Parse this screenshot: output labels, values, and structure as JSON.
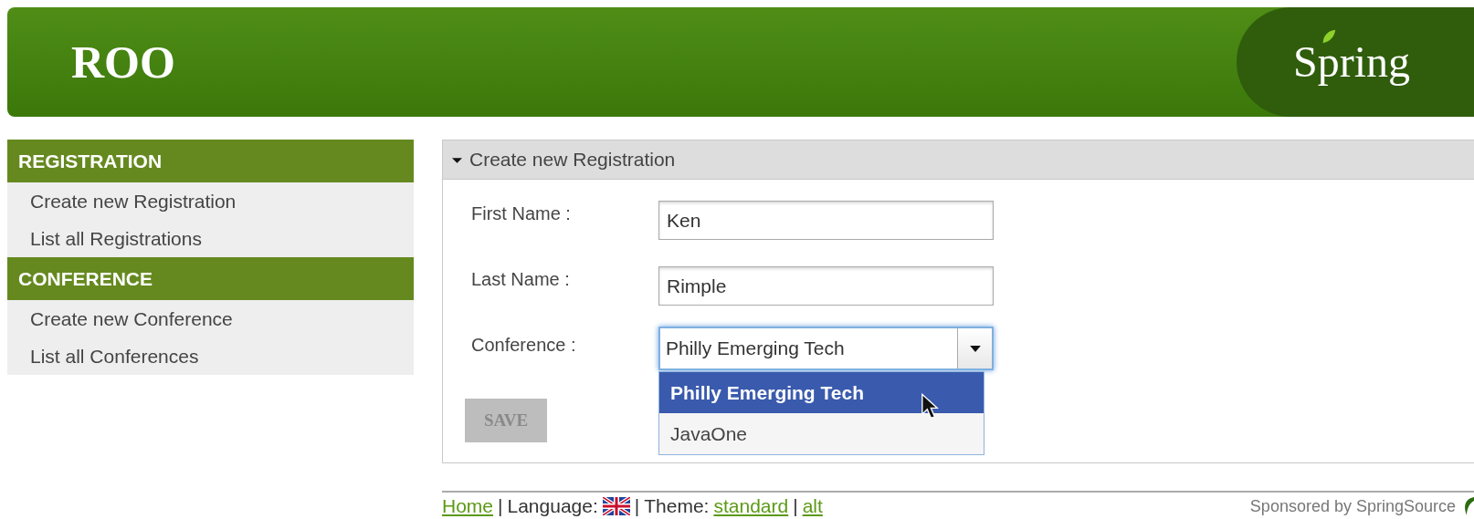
{
  "header": {
    "logo": "ROO",
    "brand": "Spring"
  },
  "sidebar": {
    "sections": [
      {
        "title": "REGISTRATION",
        "items": [
          "Create new Registration",
          "List all Registrations"
        ]
      },
      {
        "title": "CONFERENCE",
        "items": [
          "Create new Conference",
          "List all Conferences"
        ]
      }
    ]
  },
  "panel": {
    "title": "Create new Registration",
    "expanded": true,
    "fields": [
      {
        "kind": "text",
        "label": "First Name :",
        "value": "Ken"
      },
      {
        "kind": "text",
        "label": "Last Name :",
        "value": "Rimple"
      },
      {
        "kind": "combo",
        "label": "Conference :",
        "value": "Philly Emerging Tech",
        "options": [
          {
            "label": "Philly Emerging Tech",
            "selected": true
          },
          {
            "label": "JavaOne",
            "selected": false
          }
        ]
      }
    ],
    "save_button": {
      "label": "SAVE",
      "disabled": true
    }
  },
  "footer": {
    "parts": [
      {
        "kind": "link",
        "text": "Home"
      },
      {
        "kind": "sep",
        "text": "|"
      },
      {
        "kind": "text",
        "text": "Language:"
      },
      {
        "kind": "flag"
      },
      {
        "kind": "sep",
        "text": "|"
      },
      {
        "kind": "text",
        "text": "Theme:"
      },
      {
        "kind": "link",
        "text": "standard"
      },
      {
        "kind": "sep",
        "text": "|"
      },
      {
        "kind": "link",
        "text": "alt"
      }
    ],
    "sponsor": "Sponsored by SpringSource"
  }
}
